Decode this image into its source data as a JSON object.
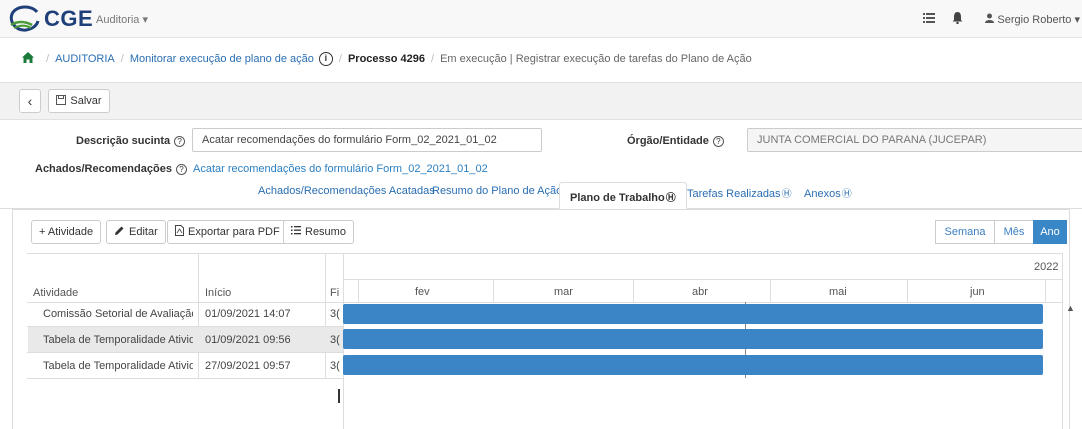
{
  "navbar": {
    "logo_text": "CGE",
    "module_menu": "Auditoria ▾",
    "list_icon": "list-icon",
    "bell_icon": "bell-icon",
    "user": "Sergio Roberto ▾"
  },
  "breadcrumb": {
    "items": [
      "AUDITORIA",
      "Monitorar execução de plano de ação",
      "Processo 4296",
      "Em execução | Registrar execução de tarefas do Plano de Ação"
    ],
    "info_glyph": "i"
  },
  "toolbar": {
    "back_glyph": "‹",
    "save_label": "Salvar"
  },
  "form": {
    "descricao_label": "Descrição sucinta",
    "descricao_value": "Acatar recomendações do formulário Form_02_2021_01_02",
    "orgao_label": "Órgão/Entidade",
    "orgao_value": "JUNTA COMERCIAL DO PARANA (JUCEPAR)",
    "achados_label": "Achados/Recomendações",
    "achados_link": "Acatar recomendações do formulário Form_02_2021_01_02",
    "help_glyph": "?"
  },
  "tabs": [
    {
      "label": "Achados/Recomendações Acatadas",
      "active": false
    },
    {
      "label": "Resumo do Plano de Ação",
      "active": false
    },
    {
      "label": "Plano de Trabalho",
      "active": true
    },
    {
      "label": "Tarefas Realizadas",
      "active": false
    },
    {
      "label": "Anexos",
      "active": false
    }
  ],
  "gantt": {
    "buttons": {
      "add": "+ Atividade",
      "edit": "Editar",
      "export": "Exportar para PDF",
      "summary": "Resumo"
    },
    "views": [
      "Semana",
      "Mês",
      "Ano"
    ],
    "active_view": "Ano",
    "columns": [
      "Atividade",
      "Início",
      "Fi"
    ],
    "year": "2022",
    "months": [
      "fev",
      "mar",
      "abr",
      "mai",
      "jun"
    ],
    "rows": [
      {
        "atividade": "Comissão Setorial de Avaliação ...",
        "inicio": "01/09/2021 14:07",
        "fim": "3("
      },
      {
        "atividade": "Tabela de Temporalidade Ativid...",
        "inicio": "01/09/2021 09:56",
        "fim": "3("
      },
      {
        "atividade": "Tabela de Temporalidade Ativid...",
        "inicio": "27/09/2021 09:57",
        "fim": "3("
      }
    ],
    "selected_row": 1,
    "accent_color": "#3b85c6"
  }
}
